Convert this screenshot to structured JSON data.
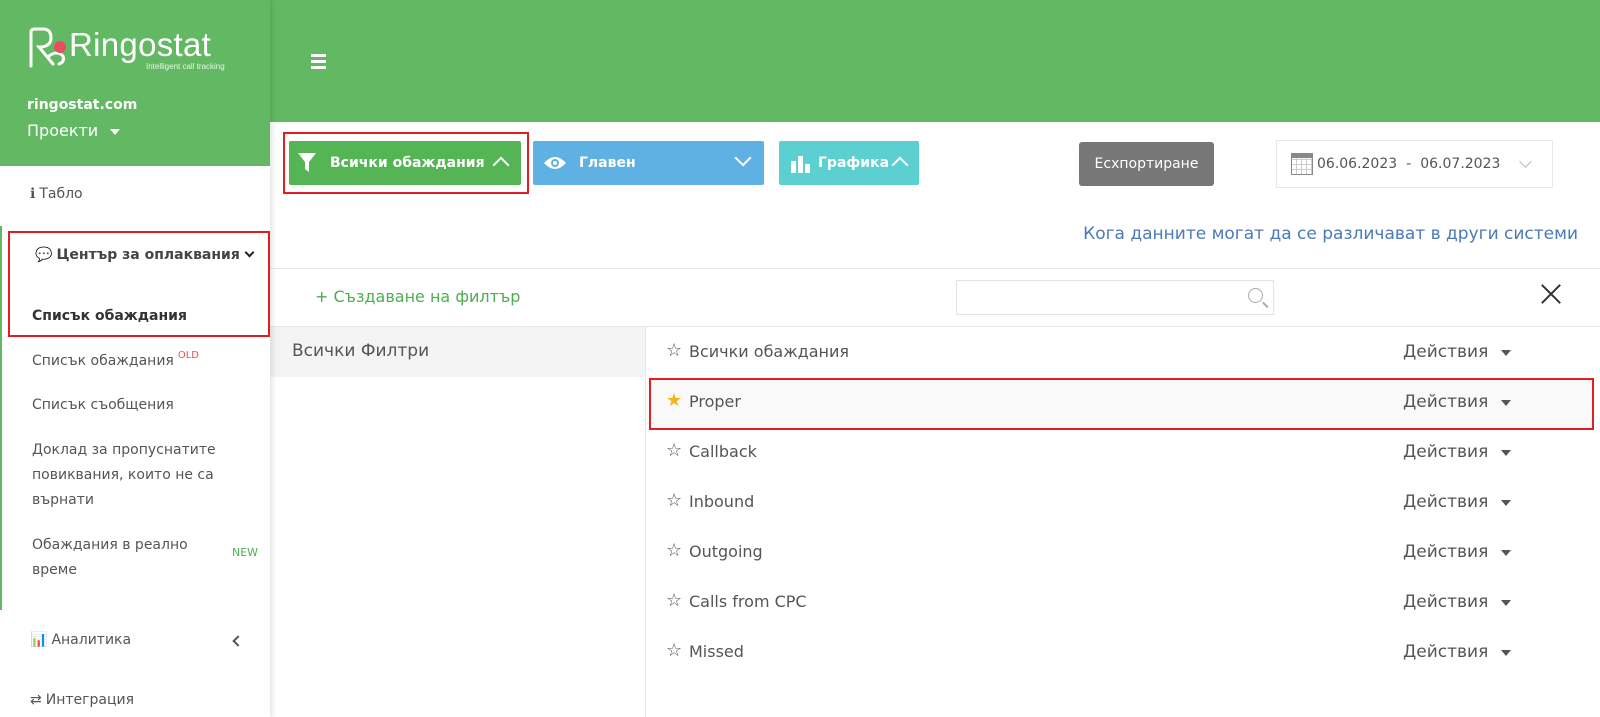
{
  "brand": {
    "name": "Ringostat",
    "tagline": "Intelligent call tracking"
  },
  "sidebar": {
    "site": "ringostat.com",
    "projects": "Проекти",
    "dashboard": "Табло",
    "call_center": "Център за оплаквания",
    "sub_items": [
      {
        "label": "Списък обаждания"
      },
      {
        "label": "Списък обаждания",
        "badge": "OLD"
      },
      {
        "label": "Списък съобщения"
      },
      {
        "label": "Доклад за пропуснатите повиквания, които не са върнати"
      },
      {
        "label": "Обаждания в реално време",
        "badge": "NEW"
      }
    ],
    "analytics": "Аналитика",
    "integration": "Интеграция"
  },
  "toolbar": {
    "all_calls": "Всички обаждания",
    "main": "Главен",
    "graphs": "Графика",
    "export": "Есхпортиране",
    "date_from": "06.06.2023",
    "date_sep": "-",
    "date_to": "06.07.2023"
  },
  "info_link": "Кога данните могат да се различават в други системи",
  "filters_panel": {
    "create_label": "+ Създаване на филтър",
    "search_placeholder": "",
    "all_filters": "Всички Филтри",
    "rows": [
      {
        "name": "Всички обаждания",
        "favorite": false,
        "actions": "Действия"
      },
      {
        "name": "Proper",
        "favorite": true,
        "actions": "Действия"
      },
      {
        "name": "Callback",
        "favorite": false,
        "actions": "Действия"
      },
      {
        "name": "Inbound",
        "favorite": false,
        "actions": "Действия"
      },
      {
        "name": "Outgoing",
        "favorite": false,
        "actions": "Действия"
      },
      {
        "name": "Calls from CPC",
        "favorite": false,
        "actions": "Действия"
      },
      {
        "name": "Missed",
        "favorite": false,
        "actions": "Действия"
      }
    ]
  },
  "colors": {
    "primary_green": "#63b963",
    "highlight_red": "#e02020",
    "favorite_star": "#f5b41c",
    "link_blue": "#4a7ab8"
  }
}
